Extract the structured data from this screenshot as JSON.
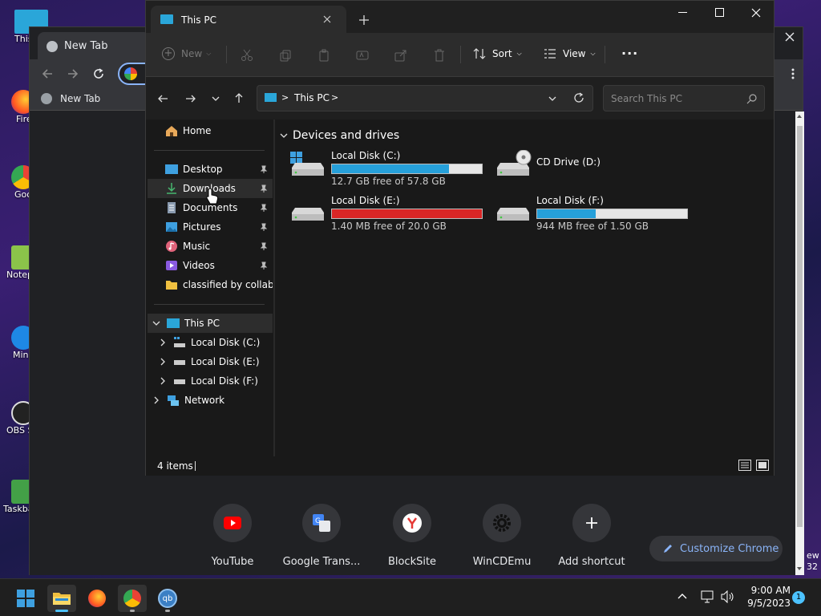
{
  "desktop": {
    "icons": [
      {
        "label": "This PC"
      },
      {
        "label": "Firefox"
      },
      {
        "label": "Google Chrome"
      },
      {
        "label": "Notepad"
      },
      {
        "label": "Mini Paint"
      },
      {
        "label": "OBS S"
      },
      {
        "label": "Taskbar"
      }
    ],
    "right_edge_text": "ew",
    "right_edge_text2": "32"
  },
  "chrome": {
    "tab_title": "New Tab",
    "bookmark_label": "New Tab",
    "shortcuts": [
      {
        "name": "YouTube",
        "color": "#ff0000"
      },
      {
        "name": "Google Trans...",
        "color": "#4285f4"
      },
      {
        "name": "BlockSite",
        "color": "#e53935"
      },
      {
        "name": "WinCDEmu",
        "color": "#444444"
      },
      {
        "name": "Add shortcut",
        "color": "#ffffff"
      }
    ],
    "customize_label": "Customize Chrome"
  },
  "explorer": {
    "tab_title": "This PC",
    "toolbar": {
      "new_label": "New",
      "sort_label": "Sort",
      "view_label": "View",
      "more_label": "..."
    },
    "address": {
      "crumb": "This PC",
      "search_placeholder": "Search This PC"
    },
    "nav": {
      "home": "Home",
      "quick": [
        {
          "label": "Desktop"
        },
        {
          "label": "Downloads"
        },
        {
          "label": "Documents"
        },
        {
          "label": "Pictures"
        },
        {
          "label": "Music"
        },
        {
          "label": "Videos"
        },
        {
          "label": "classified by collabne"
        }
      ],
      "this_pc": "This PC",
      "drives": [
        {
          "label": "Local Disk (C:)"
        },
        {
          "label": "Local Disk (E:)"
        },
        {
          "label": "Local Disk (F:)"
        }
      ],
      "network": "Network"
    },
    "section_title": "Devices and drives",
    "drives": [
      {
        "name": "Local Disk (C:)",
        "free": "12.7 GB free of 57.8 GB",
        "used_fraction": 0.78,
        "bar_color": "#26a0da"
      },
      {
        "name": "CD Drive (D:)",
        "free": "",
        "used_fraction": 0,
        "bar_color": ""
      },
      {
        "name": "Local Disk (E:)",
        "free": "1.40 MB free of 20.0 GB",
        "used_fraction": 1.0,
        "bar_color": "#da2626"
      },
      {
        "name": "Local Disk (F:)",
        "free": "944 MB free of 1.50 GB",
        "used_fraction": 0.39,
        "bar_color": "#26a0da"
      }
    ],
    "status": "4 items"
  },
  "taskbar": {
    "time": "9:00 AM",
    "date": "9/5/2023",
    "notification_count": "1"
  }
}
